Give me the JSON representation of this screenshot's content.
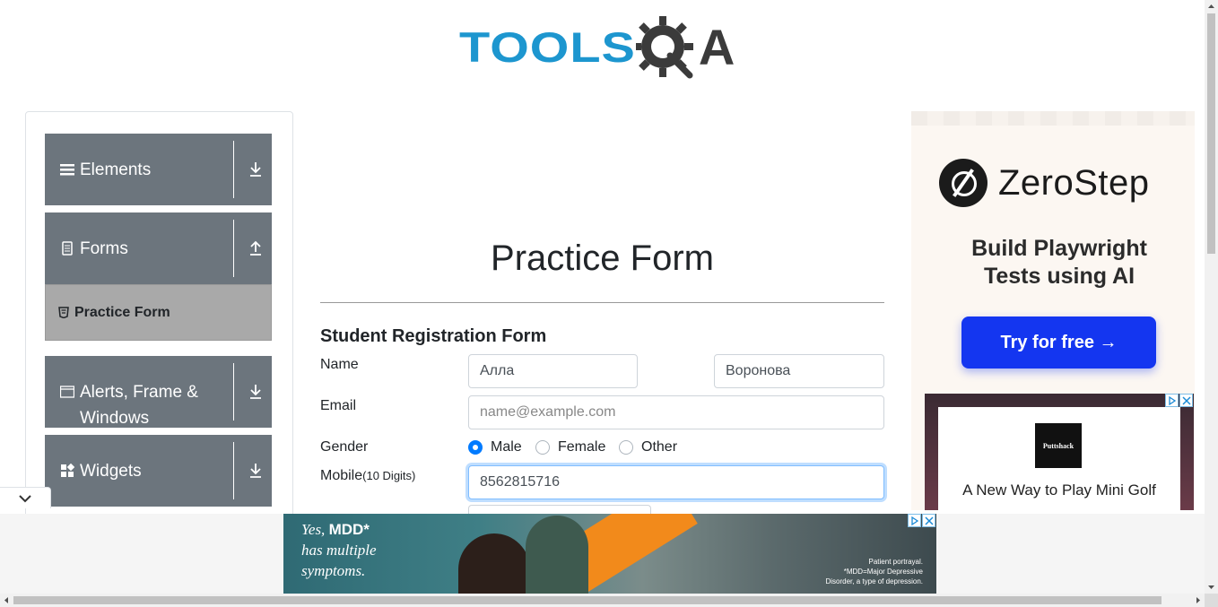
{
  "header": {
    "logo_tools": "TOOLS",
    "logo_qa": "QA"
  },
  "sidebar": {
    "groups": [
      {
        "label": "Elements",
        "icon": "menu-icon",
        "expanded": false
      },
      {
        "label": "Forms",
        "icon": "document-icon",
        "expanded": true
      },
      {
        "label": "Alerts, Frame & Windows",
        "icon": "window-icon",
        "expanded": false
      },
      {
        "label": "Widgets",
        "icon": "widgets-icon",
        "expanded": false
      }
    ],
    "forms_items": [
      {
        "label": "Practice Form",
        "active": true
      }
    ]
  },
  "main": {
    "page_title": "Practice Form",
    "form_title": "Student Registration Form",
    "name_label": "Name",
    "first_name_value": "Алла",
    "last_name_value": "Воронова",
    "email_label": "Email",
    "email_placeholder": "name@example.com",
    "gender_label": "Gender",
    "gender_options": [
      "Male",
      "Female",
      "Other"
    ],
    "gender_selected": "Male",
    "mobile_label": "Mobile",
    "mobile_hint": "(10 Digits)",
    "mobile_value": "8562815716"
  },
  "ads": {
    "right": {
      "brand": "ZeroStep",
      "headline_line1": "Build Playwright",
      "headline_line2": "Tests using AI",
      "cta": "Try for free →"
    },
    "right_secondary": {
      "logo_text": "Puttshack",
      "text": "A New Way to Play Mini Golf"
    },
    "bottom": {
      "line1_prefix": "Yes, ",
      "line1_bold": "MDD*",
      "line2": "has multiple",
      "line3": "symptoms.",
      "fine1": "Patient portrayal.",
      "fine2": "*MDD=Major Depressive",
      "fine3": "Disorder, a type of depression."
    }
  },
  "colors": {
    "accent": "#1d96cf",
    "sidebar_group": "#6c757d",
    "sidebar_active": "#a9a9a9",
    "cta": "#1436f0"
  }
}
